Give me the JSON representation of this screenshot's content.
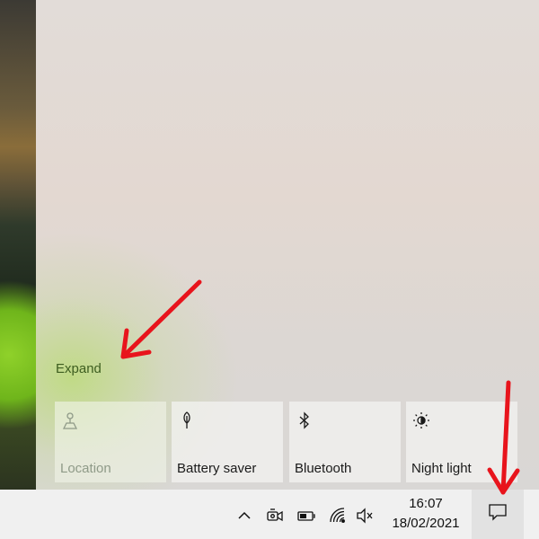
{
  "action_center": {
    "expand_label": "Expand",
    "quick_actions": [
      {
        "label": "Location",
        "icon": "location-icon",
        "enabled": false
      },
      {
        "label": "Battery saver",
        "icon": "battery-saver-icon",
        "enabled": true
      },
      {
        "label": "Bluetooth",
        "icon": "bluetooth-icon",
        "enabled": true
      },
      {
        "label": "Night light",
        "icon": "night-light-icon",
        "enabled": true
      }
    ]
  },
  "taskbar": {
    "tray_icons": [
      "chevron-up-icon",
      "meet-now-icon",
      "battery-icon",
      "wifi-icon",
      "volume-muted-icon"
    ],
    "time": "16:07",
    "date": "18/02/2021",
    "notification_icon": "action-center-icon"
  },
  "annotations": {
    "arrow_color": "#e8141c"
  },
  "colors": {
    "taskbar_bg": "#f0f0f0",
    "expand_text": "#3e5e20",
    "wallpaper_green": "#8fd12a"
  }
}
